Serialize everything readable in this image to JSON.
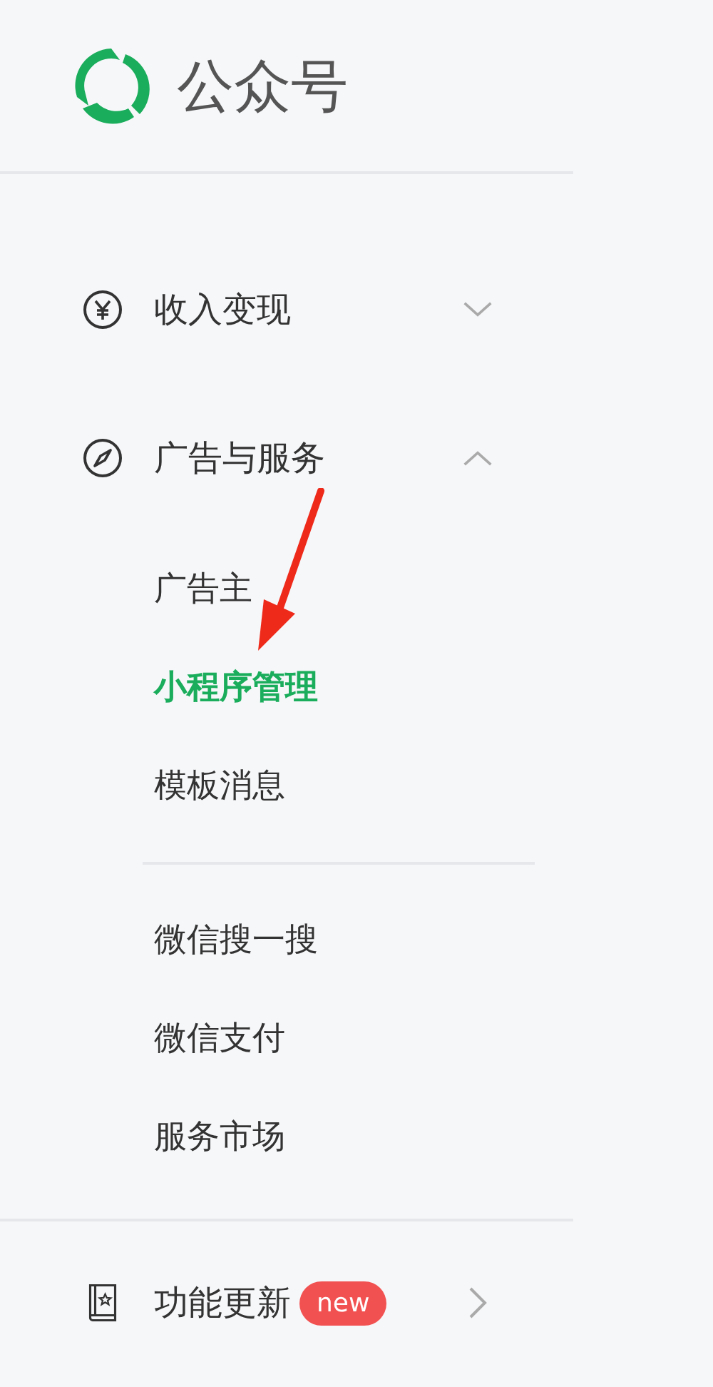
{
  "header": {
    "title": "公众号"
  },
  "menu": [
    {
      "kind": "yen",
      "label": "收入变现",
      "expanded": false
    },
    {
      "kind": "compass",
      "label": "广告与服务",
      "expanded": true,
      "groups": [
        {
          "items": [
            {
              "label": "广告主",
              "selected": false
            },
            {
              "label": "小程序管理",
              "selected": true
            },
            {
              "label": "模板消息",
              "selected": false
            }
          ]
        },
        {
          "items": [
            {
              "label": "微信搜一搜",
              "selected": false
            },
            {
              "label": "微信支付",
              "selected": false
            },
            {
              "label": "服务市场",
              "selected": false
            }
          ]
        }
      ]
    }
  ],
  "footer_item": {
    "label": "功能更新",
    "badge": "new"
  }
}
